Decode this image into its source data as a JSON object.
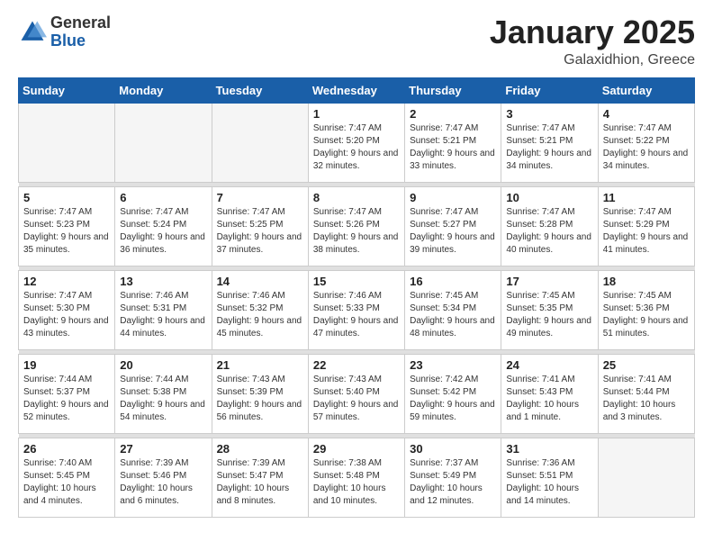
{
  "logo": {
    "general": "General",
    "blue": "Blue"
  },
  "header": {
    "title": "January 2025",
    "subtitle": "Galaxidhion, Greece"
  },
  "weekdays": [
    "Sunday",
    "Monday",
    "Tuesday",
    "Wednesday",
    "Thursday",
    "Friday",
    "Saturday"
  ],
  "weeks": [
    [
      {
        "day": "",
        "info": ""
      },
      {
        "day": "",
        "info": ""
      },
      {
        "day": "",
        "info": ""
      },
      {
        "day": "1",
        "info": "Sunrise: 7:47 AM\nSunset: 5:20 PM\nDaylight: 9 hours and 32 minutes."
      },
      {
        "day": "2",
        "info": "Sunrise: 7:47 AM\nSunset: 5:21 PM\nDaylight: 9 hours and 33 minutes."
      },
      {
        "day": "3",
        "info": "Sunrise: 7:47 AM\nSunset: 5:21 PM\nDaylight: 9 hours and 34 minutes."
      },
      {
        "day": "4",
        "info": "Sunrise: 7:47 AM\nSunset: 5:22 PM\nDaylight: 9 hours and 34 minutes."
      }
    ],
    [
      {
        "day": "5",
        "info": "Sunrise: 7:47 AM\nSunset: 5:23 PM\nDaylight: 9 hours and 35 minutes."
      },
      {
        "day": "6",
        "info": "Sunrise: 7:47 AM\nSunset: 5:24 PM\nDaylight: 9 hours and 36 minutes."
      },
      {
        "day": "7",
        "info": "Sunrise: 7:47 AM\nSunset: 5:25 PM\nDaylight: 9 hours and 37 minutes."
      },
      {
        "day": "8",
        "info": "Sunrise: 7:47 AM\nSunset: 5:26 PM\nDaylight: 9 hours and 38 minutes."
      },
      {
        "day": "9",
        "info": "Sunrise: 7:47 AM\nSunset: 5:27 PM\nDaylight: 9 hours and 39 minutes."
      },
      {
        "day": "10",
        "info": "Sunrise: 7:47 AM\nSunset: 5:28 PM\nDaylight: 9 hours and 40 minutes."
      },
      {
        "day": "11",
        "info": "Sunrise: 7:47 AM\nSunset: 5:29 PM\nDaylight: 9 hours and 41 minutes."
      }
    ],
    [
      {
        "day": "12",
        "info": "Sunrise: 7:47 AM\nSunset: 5:30 PM\nDaylight: 9 hours and 43 minutes."
      },
      {
        "day": "13",
        "info": "Sunrise: 7:46 AM\nSunset: 5:31 PM\nDaylight: 9 hours and 44 minutes."
      },
      {
        "day": "14",
        "info": "Sunrise: 7:46 AM\nSunset: 5:32 PM\nDaylight: 9 hours and 45 minutes."
      },
      {
        "day": "15",
        "info": "Sunrise: 7:46 AM\nSunset: 5:33 PM\nDaylight: 9 hours and 47 minutes."
      },
      {
        "day": "16",
        "info": "Sunrise: 7:45 AM\nSunset: 5:34 PM\nDaylight: 9 hours and 48 minutes."
      },
      {
        "day": "17",
        "info": "Sunrise: 7:45 AM\nSunset: 5:35 PM\nDaylight: 9 hours and 49 minutes."
      },
      {
        "day": "18",
        "info": "Sunrise: 7:45 AM\nSunset: 5:36 PM\nDaylight: 9 hours and 51 minutes."
      }
    ],
    [
      {
        "day": "19",
        "info": "Sunrise: 7:44 AM\nSunset: 5:37 PM\nDaylight: 9 hours and 52 minutes."
      },
      {
        "day": "20",
        "info": "Sunrise: 7:44 AM\nSunset: 5:38 PM\nDaylight: 9 hours and 54 minutes."
      },
      {
        "day": "21",
        "info": "Sunrise: 7:43 AM\nSunset: 5:39 PM\nDaylight: 9 hours and 56 minutes."
      },
      {
        "day": "22",
        "info": "Sunrise: 7:43 AM\nSunset: 5:40 PM\nDaylight: 9 hours and 57 minutes."
      },
      {
        "day": "23",
        "info": "Sunrise: 7:42 AM\nSunset: 5:42 PM\nDaylight: 9 hours and 59 minutes."
      },
      {
        "day": "24",
        "info": "Sunrise: 7:41 AM\nSunset: 5:43 PM\nDaylight: 10 hours and 1 minute."
      },
      {
        "day": "25",
        "info": "Sunrise: 7:41 AM\nSunset: 5:44 PM\nDaylight: 10 hours and 3 minutes."
      }
    ],
    [
      {
        "day": "26",
        "info": "Sunrise: 7:40 AM\nSunset: 5:45 PM\nDaylight: 10 hours and 4 minutes."
      },
      {
        "day": "27",
        "info": "Sunrise: 7:39 AM\nSunset: 5:46 PM\nDaylight: 10 hours and 6 minutes."
      },
      {
        "day": "28",
        "info": "Sunrise: 7:39 AM\nSunset: 5:47 PM\nDaylight: 10 hours and 8 minutes."
      },
      {
        "day": "29",
        "info": "Sunrise: 7:38 AM\nSunset: 5:48 PM\nDaylight: 10 hours and 10 minutes."
      },
      {
        "day": "30",
        "info": "Sunrise: 7:37 AM\nSunset: 5:49 PM\nDaylight: 10 hours and 12 minutes."
      },
      {
        "day": "31",
        "info": "Sunrise: 7:36 AM\nSunset: 5:51 PM\nDaylight: 10 hours and 14 minutes."
      },
      {
        "day": "",
        "info": ""
      }
    ]
  ]
}
